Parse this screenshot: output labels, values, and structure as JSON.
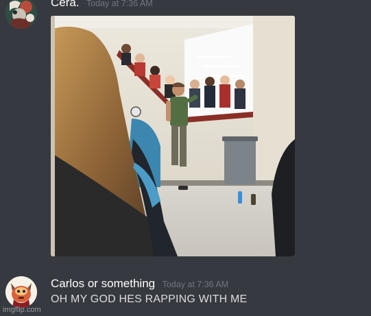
{
  "messages": [
    {
      "username": "Cera.",
      "timestamp": "Today at 7:36 AM",
      "attachment": {
        "type": "video-still",
        "description_hidden": true
      }
    },
    {
      "username": "Carlos or something",
      "timestamp": "Today at 7:36 AM",
      "text": "OH MY GOD HES RAPPING WITH ME"
    }
  ],
  "watermark": "imgflip.com",
  "colors": {
    "background": "#36393f",
    "username": "#ffffff",
    "timestamp": "#72767d",
    "message_text": "#dcddde"
  }
}
